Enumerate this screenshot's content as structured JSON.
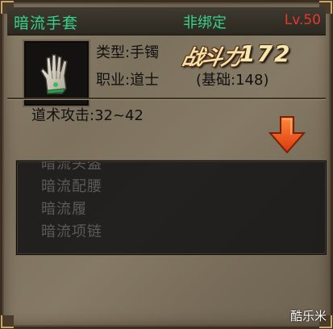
{
  "item": {
    "name": "暗流手套",
    "bind_status": "非绑定",
    "level": "Lv.50",
    "type_label": "类型:",
    "type_value": "手镯",
    "class_label": "职业:",
    "class_value": "道士",
    "power_label": "战斗力",
    "power_value": "172",
    "base_text": "(基础:148)",
    "stat_text": "道术攻击:32~42"
  },
  "set_items": [
    "暗流头盔",
    "暗流配腰",
    "暗流履",
    "暗流项链"
  ],
  "watermark": "酷乐米",
  "icons": {
    "item": "glove-icon",
    "expand": "down-arrow-icon"
  },
  "colors": {
    "name": "#36d28a",
    "level": "#e23a2e",
    "arrow": "#f05a1e"
  }
}
